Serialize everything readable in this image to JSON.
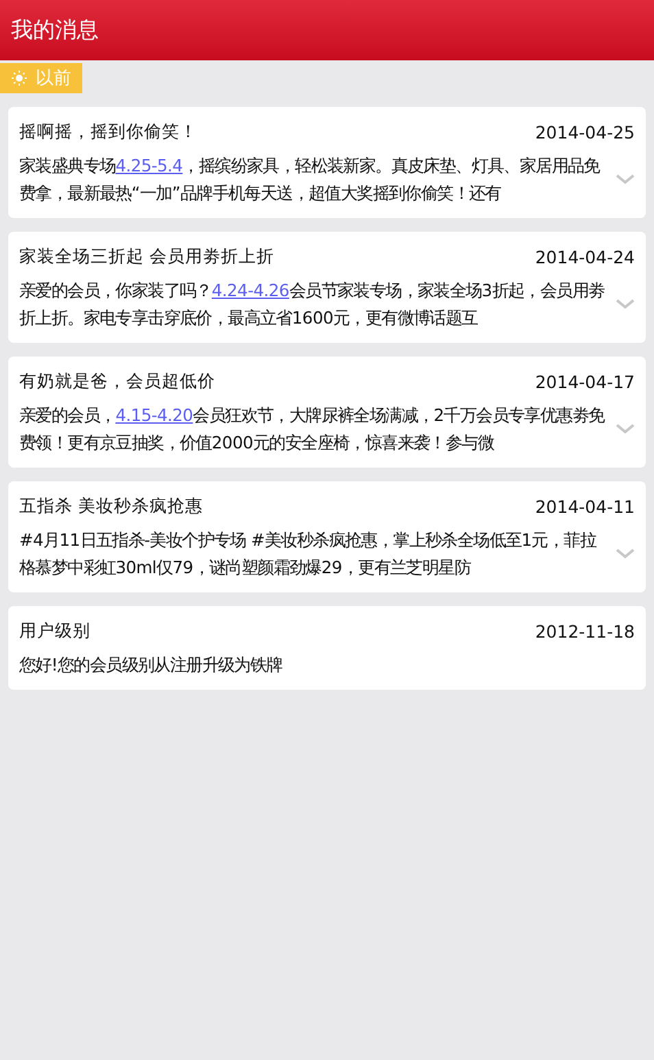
{
  "header": {
    "title": "我的消息"
  },
  "section": {
    "label": "以前"
  },
  "messages": [
    {
      "title": "摇啊摇，摇到你偷笑！",
      "date": "2014-04-25",
      "expandable": true,
      "body": [
        {
          "kind": "text",
          "text": "家装盛典专场"
        },
        {
          "kind": "link",
          "text": "4.25-5.4"
        },
        {
          "kind": "text",
          "text": "，摇缤纷家具，轻松装新家。真皮床垫、灯具、家居用品免费拿，最新最热“一加”品牌手机每天送，超值大奖摇到你偷笑！还有"
        }
      ]
    },
    {
      "title": "家装全场三折起 会员用劵折上折",
      "date": "2014-04-24",
      "expandable": true,
      "body": [
        {
          "kind": "text",
          "text": "亲爱的会员，你家装了吗？"
        },
        {
          "kind": "link",
          "text": "4.24-4.26"
        },
        {
          "kind": "text",
          "text": "会员节家装专场，家装全场3折起，会员用劵折上折。家电专享击穿底价，最高立省1600元，更有微博话题互"
        }
      ]
    },
    {
      "title": "有奶就是爸，会员超低价",
      "date": "2014-04-17",
      "expandable": true,
      "body": [
        {
          "kind": "text",
          "text": "亲爱的会员，"
        },
        {
          "kind": "link",
          "text": "4.15-4.20"
        },
        {
          "kind": "text",
          "text": "会员狂欢节，大牌尿裤全场满减，2千万会员专享优惠劵免费领！更有京豆抽奖，价值2000元的安全座椅，惊喜来袭！参与微"
        }
      ]
    },
    {
      "title": "五指杀 美妆秒杀疯抢惠",
      "date": "2014-04-11",
      "expandable": true,
      "body": [
        {
          "kind": "text",
          "text": "#4月11日五指杀-美妆个护专场 #美妆秒杀疯抢惠，掌上秒杀全场低至1元，菲拉格慕梦中彩虹30ml仅79，谜尚塑颜霜劲爆29，更有兰芝明星防"
        }
      ]
    },
    {
      "title": "用户级别",
      "date": "2012-11-18",
      "expandable": false,
      "body": [
        {
          "kind": "text",
          "text": "您好!您的会员级别从注册升级为铁牌"
        }
      ]
    }
  ]
}
